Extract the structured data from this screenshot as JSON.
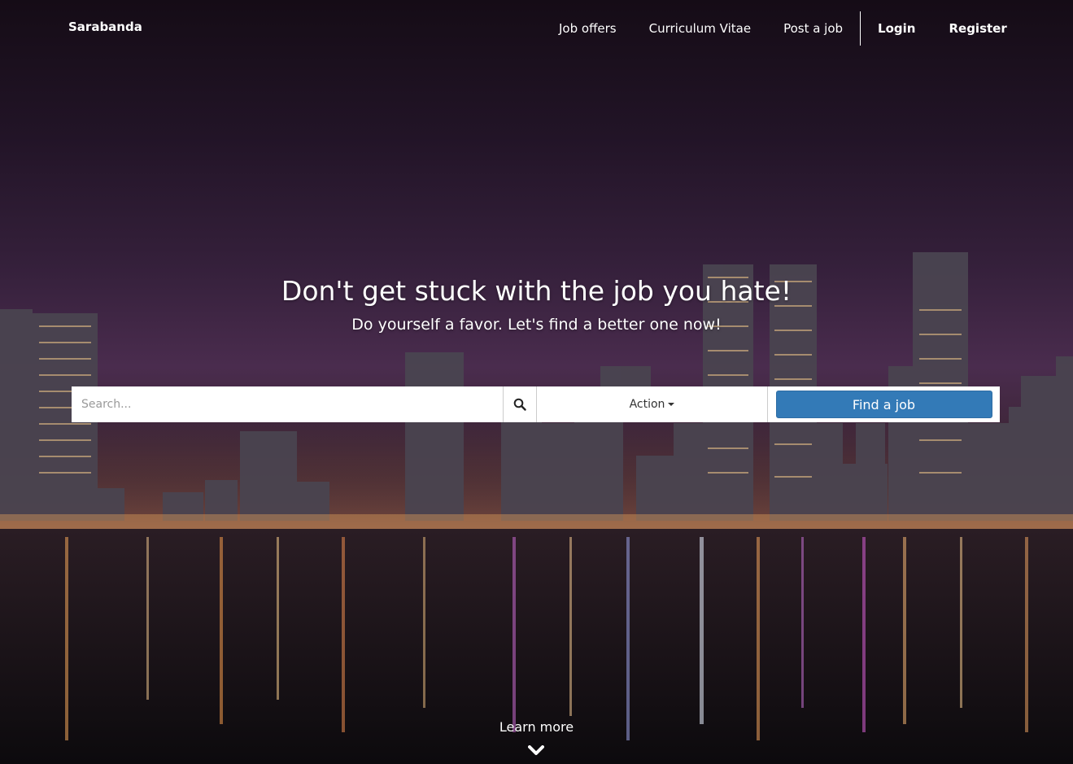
{
  "brand": "Sarabanda",
  "nav": {
    "job_offers": "Job offers",
    "cv": "Curriculum Vitae",
    "post_job": "Post a job",
    "login": "Login",
    "register": "Register"
  },
  "hero": {
    "title": "Don't get stuck with the job you hate!",
    "subtitle": "Do yourself a favor. Let's find a better one now!"
  },
  "search": {
    "placeholder": "Search...",
    "action_label": "Action",
    "find_label": "Find a job"
  },
  "learn_more": "Learn more",
  "colors": {
    "primary_button": "#337ab7"
  }
}
